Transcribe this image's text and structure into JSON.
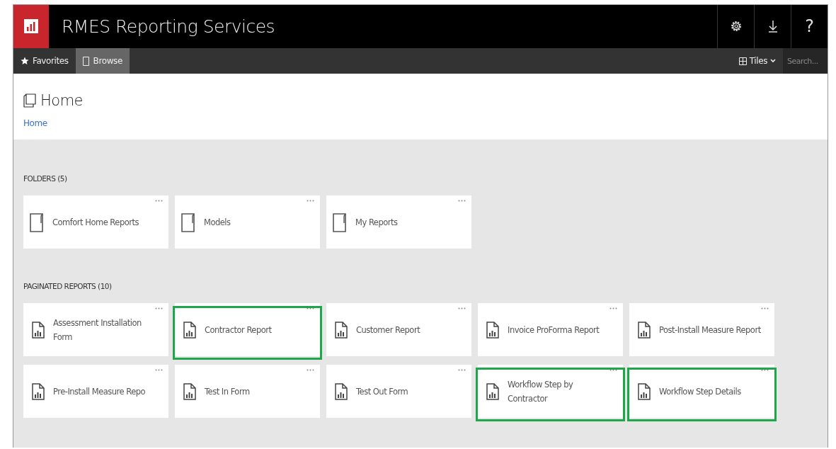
{
  "app_title": "RMES Reporting Services",
  "header_buttons": [
    {
      "kind": "settings"
    },
    {
      "kind": "download"
    },
    {
      "kind": "help",
      "label": "?"
    }
  ],
  "nav_tabs": [
    {
      "label": "Favorites",
      "kind": "favorites",
      "selected": false
    },
    {
      "label": "Browse",
      "kind": "browse",
      "selected": true
    }
  ],
  "view_menu": {
    "label": "Tiles"
  },
  "search": {
    "placeholder": "Search..."
  },
  "page": {
    "title": "Home",
    "breadcrumb": "Home"
  },
  "sections": [
    {
      "heading": "FOLDERS (5)",
      "kind": "folder",
      "items": [
        {
          "label": "Comfort Home Reports",
          "highlighted": false
        },
        {
          "label": "Models",
          "highlighted": false
        },
        {
          "label": "My Reports",
          "highlighted": false
        }
      ]
    },
    {
      "heading": "PAGINATED REPORTS (10)",
      "kind": "report",
      "items": [
        {
          "label": "Assessment Installation Form",
          "highlighted": false
        },
        {
          "label": "Contractor Report",
          "highlighted": true
        },
        {
          "label": "Customer Report",
          "highlighted": false
        },
        {
          "label": "Invoice ProForma Report",
          "highlighted": false
        },
        {
          "label": "Post-Install Measure Report",
          "highlighted": false
        },
        {
          "label": "Pre-Install Measure Repo",
          "highlighted": false
        },
        {
          "label": "Test In Form",
          "highlighted": false
        },
        {
          "label": "Test Out Form",
          "highlighted": false
        },
        {
          "label": "Workflow Step by Contractor",
          "highlighted": true
        },
        {
          "label": "Workflow Step Details",
          "highlighted": true
        }
      ]
    }
  ]
}
